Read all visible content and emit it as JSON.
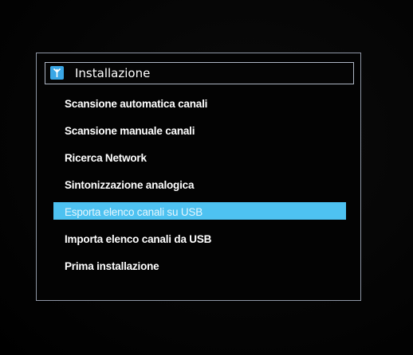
{
  "menu": {
    "title": "Installazione",
    "title_icon": "antenna-icon",
    "selected_index": 4,
    "items": [
      {
        "label": "Scansione automatica canali"
      },
      {
        "label": "Scansione manuale canali"
      },
      {
        "label": "Ricerca Network"
      },
      {
        "label": "Sintonizzazione analogica"
      },
      {
        "label": "Esporta elenco canali su USB"
      },
      {
        "label": "Importa elenco canali da USB"
      },
      {
        "label": "Prima installazione"
      }
    ]
  },
  "colors": {
    "highlight": "#4ec2f1",
    "icon_background": "#3aa7e6",
    "panel_border": "#8f97a6",
    "text": "#ffffff"
  }
}
